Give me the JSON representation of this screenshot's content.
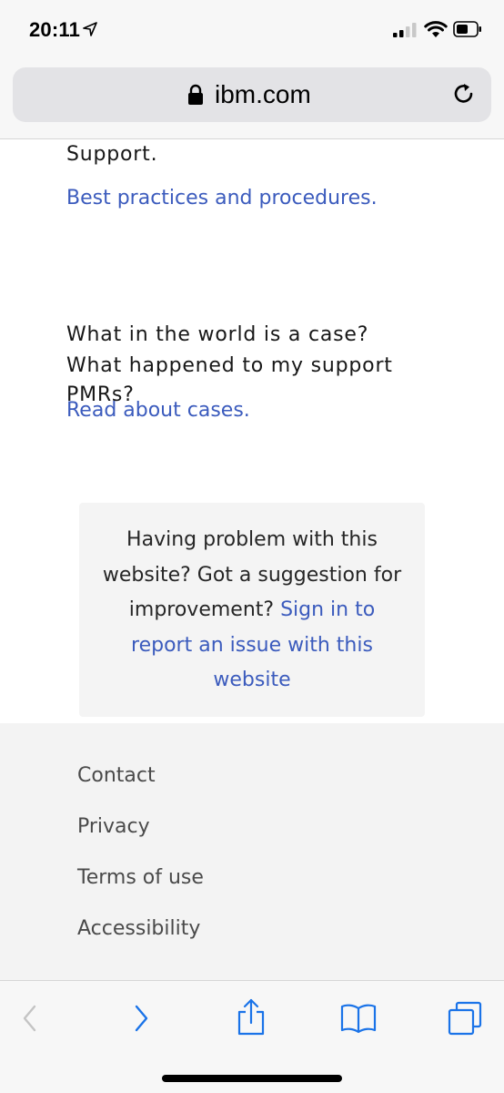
{
  "status_bar": {
    "time": "20:11"
  },
  "browser": {
    "url": "ibm.com"
  },
  "content": {
    "support_text": "Support.",
    "best_practices_link": "Best practices and procedures.",
    "case_question_line1": "What in the world is a case?",
    "case_question_line2": "What happened to my support",
    "case_question_line3": "PMRs?",
    "read_cases_link": "Read about cases.",
    "feedback": {
      "line1": "Having problem with this",
      "line2": "website? Got a suggestion for",
      "line3_text": "improvement?",
      "line3_link": "Sign in to",
      "line4_link": "report an issue with this",
      "line5_link": "website"
    }
  },
  "footer": {
    "links": [
      "Contact",
      "Privacy",
      "Terms of use",
      "Accessibility"
    ]
  },
  "toolbar": {
    "icons": [
      "back-icon",
      "forward-icon",
      "share-icon",
      "bookmarks-icon",
      "tabs-icon"
    ]
  },
  "colors": {
    "link": "#3b5bbd",
    "ios_blue": "#1a73e8",
    "disabled": "#c4c4c4",
    "footer_bg": "#f3f3f3"
  }
}
